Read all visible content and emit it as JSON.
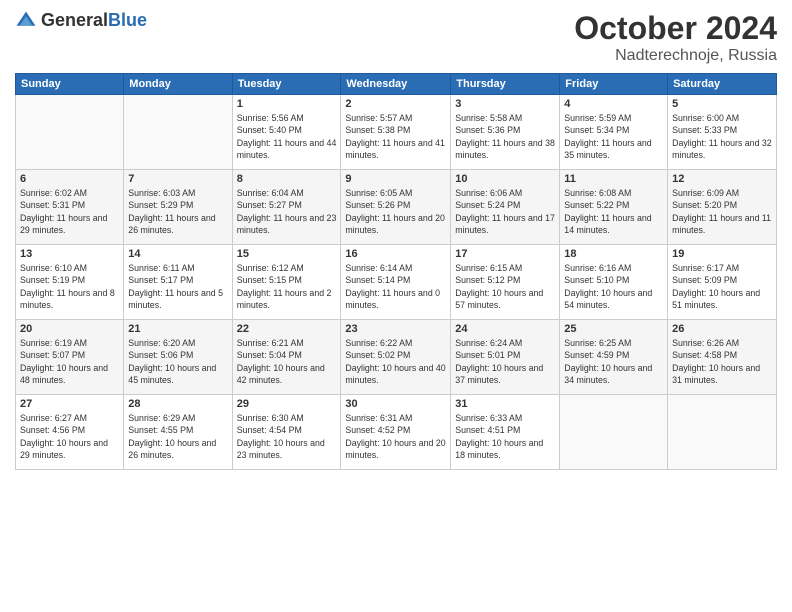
{
  "header": {
    "logo_general": "General",
    "logo_blue": "Blue",
    "month": "October 2024",
    "location": "Nadterechnoje, Russia"
  },
  "days_of_week": [
    "Sunday",
    "Monday",
    "Tuesday",
    "Wednesday",
    "Thursday",
    "Friday",
    "Saturday"
  ],
  "weeks": [
    [
      {
        "day": "",
        "sunrise": "",
        "sunset": "",
        "daylight": ""
      },
      {
        "day": "",
        "sunrise": "",
        "sunset": "",
        "daylight": ""
      },
      {
        "day": "1",
        "sunrise": "Sunrise: 5:56 AM",
        "sunset": "Sunset: 5:40 PM",
        "daylight": "Daylight: 11 hours and 44 minutes."
      },
      {
        "day": "2",
        "sunrise": "Sunrise: 5:57 AM",
        "sunset": "Sunset: 5:38 PM",
        "daylight": "Daylight: 11 hours and 41 minutes."
      },
      {
        "day": "3",
        "sunrise": "Sunrise: 5:58 AM",
        "sunset": "Sunset: 5:36 PM",
        "daylight": "Daylight: 11 hours and 38 minutes."
      },
      {
        "day": "4",
        "sunrise": "Sunrise: 5:59 AM",
        "sunset": "Sunset: 5:34 PM",
        "daylight": "Daylight: 11 hours and 35 minutes."
      },
      {
        "day": "5",
        "sunrise": "Sunrise: 6:00 AM",
        "sunset": "Sunset: 5:33 PM",
        "daylight": "Daylight: 11 hours and 32 minutes."
      }
    ],
    [
      {
        "day": "6",
        "sunrise": "Sunrise: 6:02 AM",
        "sunset": "Sunset: 5:31 PM",
        "daylight": "Daylight: 11 hours and 29 minutes."
      },
      {
        "day": "7",
        "sunrise": "Sunrise: 6:03 AM",
        "sunset": "Sunset: 5:29 PM",
        "daylight": "Daylight: 11 hours and 26 minutes."
      },
      {
        "day": "8",
        "sunrise": "Sunrise: 6:04 AM",
        "sunset": "Sunset: 5:27 PM",
        "daylight": "Daylight: 11 hours and 23 minutes."
      },
      {
        "day": "9",
        "sunrise": "Sunrise: 6:05 AM",
        "sunset": "Sunset: 5:26 PM",
        "daylight": "Daylight: 11 hours and 20 minutes."
      },
      {
        "day": "10",
        "sunrise": "Sunrise: 6:06 AM",
        "sunset": "Sunset: 5:24 PM",
        "daylight": "Daylight: 11 hours and 17 minutes."
      },
      {
        "day": "11",
        "sunrise": "Sunrise: 6:08 AM",
        "sunset": "Sunset: 5:22 PM",
        "daylight": "Daylight: 11 hours and 14 minutes."
      },
      {
        "day": "12",
        "sunrise": "Sunrise: 6:09 AM",
        "sunset": "Sunset: 5:20 PM",
        "daylight": "Daylight: 11 hours and 11 minutes."
      }
    ],
    [
      {
        "day": "13",
        "sunrise": "Sunrise: 6:10 AM",
        "sunset": "Sunset: 5:19 PM",
        "daylight": "Daylight: 11 hours and 8 minutes."
      },
      {
        "day": "14",
        "sunrise": "Sunrise: 6:11 AM",
        "sunset": "Sunset: 5:17 PM",
        "daylight": "Daylight: 11 hours and 5 minutes."
      },
      {
        "day": "15",
        "sunrise": "Sunrise: 6:12 AM",
        "sunset": "Sunset: 5:15 PM",
        "daylight": "Daylight: 11 hours and 2 minutes."
      },
      {
        "day": "16",
        "sunrise": "Sunrise: 6:14 AM",
        "sunset": "Sunset: 5:14 PM",
        "daylight": "Daylight: 11 hours and 0 minutes."
      },
      {
        "day": "17",
        "sunrise": "Sunrise: 6:15 AM",
        "sunset": "Sunset: 5:12 PM",
        "daylight": "Daylight: 10 hours and 57 minutes."
      },
      {
        "day": "18",
        "sunrise": "Sunrise: 6:16 AM",
        "sunset": "Sunset: 5:10 PM",
        "daylight": "Daylight: 10 hours and 54 minutes."
      },
      {
        "day": "19",
        "sunrise": "Sunrise: 6:17 AM",
        "sunset": "Sunset: 5:09 PM",
        "daylight": "Daylight: 10 hours and 51 minutes."
      }
    ],
    [
      {
        "day": "20",
        "sunrise": "Sunrise: 6:19 AM",
        "sunset": "Sunset: 5:07 PM",
        "daylight": "Daylight: 10 hours and 48 minutes."
      },
      {
        "day": "21",
        "sunrise": "Sunrise: 6:20 AM",
        "sunset": "Sunset: 5:06 PM",
        "daylight": "Daylight: 10 hours and 45 minutes."
      },
      {
        "day": "22",
        "sunrise": "Sunrise: 6:21 AM",
        "sunset": "Sunset: 5:04 PM",
        "daylight": "Daylight: 10 hours and 42 minutes."
      },
      {
        "day": "23",
        "sunrise": "Sunrise: 6:22 AM",
        "sunset": "Sunset: 5:02 PM",
        "daylight": "Daylight: 10 hours and 40 minutes."
      },
      {
        "day": "24",
        "sunrise": "Sunrise: 6:24 AM",
        "sunset": "Sunset: 5:01 PM",
        "daylight": "Daylight: 10 hours and 37 minutes."
      },
      {
        "day": "25",
        "sunrise": "Sunrise: 6:25 AM",
        "sunset": "Sunset: 4:59 PM",
        "daylight": "Daylight: 10 hours and 34 minutes."
      },
      {
        "day": "26",
        "sunrise": "Sunrise: 6:26 AM",
        "sunset": "Sunset: 4:58 PM",
        "daylight": "Daylight: 10 hours and 31 minutes."
      }
    ],
    [
      {
        "day": "27",
        "sunrise": "Sunrise: 6:27 AM",
        "sunset": "Sunset: 4:56 PM",
        "daylight": "Daylight: 10 hours and 29 minutes."
      },
      {
        "day": "28",
        "sunrise": "Sunrise: 6:29 AM",
        "sunset": "Sunset: 4:55 PM",
        "daylight": "Daylight: 10 hours and 26 minutes."
      },
      {
        "day": "29",
        "sunrise": "Sunrise: 6:30 AM",
        "sunset": "Sunset: 4:54 PM",
        "daylight": "Daylight: 10 hours and 23 minutes."
      },
      {
        "day": "30",
        "sunrise": "Sunrise: 6:31 AM",
        "sunset": "Sunset: 4:52 PM",
        "daylight": "Daylight: 10 hours and 20 minutes."
      },
      {
        "day": "31",
        "sunrise": "Sunrise: 6:33 AM",
        "sunset": "Sunset: 4:51 PM",
        "daylight": "Daylight: 10 hours and 18 minutes."
      },
      {
        "day": "",
        "sunrise": "",
        "sunset": "",
        "daylight": ""
      },
      {
        "day": "",
        "sunrise": "",
        "sunset": "",
        "daylight": ""
      }
    ]
  ]
}
